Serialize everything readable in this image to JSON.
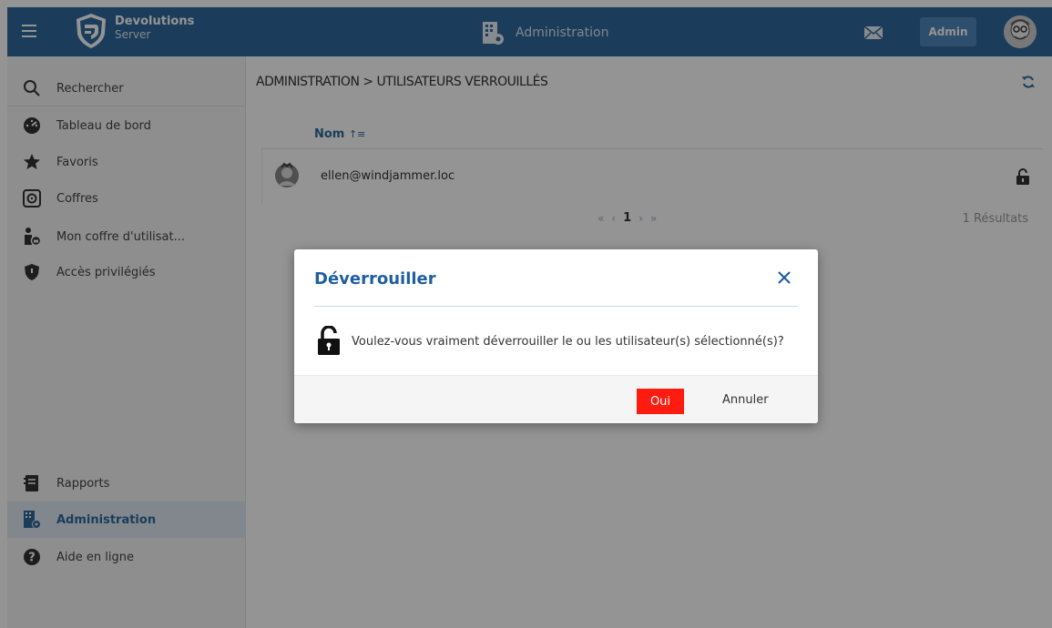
{
  "header": {
    "brand_name": "Devolutions",
    "brand_product": "Server",
    "section_title": "Administration",
    "admin_label": "Admin",
    "color": "#2f6a9e"
  },
  "sidebar": {
    "top_items": [
      {
        "label": "Rechercher",
        "icon": "search-icon"
      },
      {
        "label": "Tableau de bord",
        "icon": "dashboard-icon"
      },
      {
        "label": "Favoris",
        "icon": "star-icon"
      },
      {
        "label": "Coffres",
        "icon": "vault-icon"
      },
      {
        "label": "Mon coffre d'utilisat...",
        "icon": "user-vault-icon"
      },
      {
        "label": "Accès privilégiés",
        "icon": "shield-icon"
      }
    ],
    "bottom_items": [
      {
        "label": "Rapports",
        "icon": "reports-icon"
      },
      {
        "label": "Administration",
        "icon": "administration-icon",
        "active": true
      },
      {
        "label": "Aide en ligne",
        "icon": "help-icon"
      }
    ]
  },
  "main": {
    "breadcrumb": "ADMINISTRATION > UTILISATEURS VERROUILLÉS",
    "column_name": "Nom",
    "rows": [
      {
        "name": "ellen@windjammer.loc",
        "icon": "user-avatar-icon",
        "action_icon": "unlock-icon"
      }
    ],
    "pager": {
      "first": "«",
      "prev": "‹",
      "current": "1",
      "next": "›",
      "last": "»"
    },
    "results": "1 Résultats"
  },
  "dialog": {
    "title": "Déverrouiller",
    "message": "Voulez-vous vraiment déverrouiller le ou les utilisateur(s) sélectionné(s)?",
    "confirm_label": "Oui",
    "cancel_label": "Annuler",
    "confirm_color": "#ff1b10"
  }
}
